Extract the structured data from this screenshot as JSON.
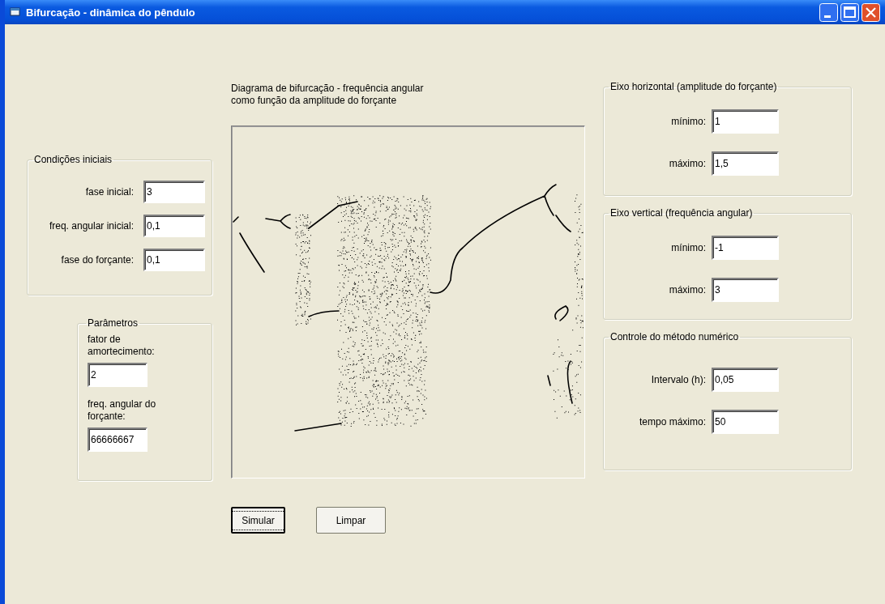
{
  "window": {
    "title": "Bifurcação - dinâmica do pêndulo"
  },
  "initial_conditions": {
    "title": "Condições iniciais",
    "kind": "inline",
    "fields": [
      {
        "label": "fase inicial:",
        "value": "3"
      },
      {
        "label": "freq. angular inicial:",
        "value": "0,1"
      },
      {
        "label": "fase do forçante:",
        "value": "0,1"
      }
    ]
  },
  "parameters": {
    "title": "Parâmetros",
    "kind": "stacked",
    "fields": [
      {
        "label": "fator de amortecimento:",
        "value": "2"
      },
      {
        "label": "freq. angular do forçante:",
        "value": "66666667"
      }
    ]
  },
  "plot": {
    "caption": [
      "Diagrama de bifurcação - frequência angular",
      "como função da amplitude do forçante"
    ]
  },
  "buttons": [
    {
      "label": "Simular",
      "default": true
    },
    {
      "label": "Limpar",
      "default": false
    }
  ],
  "right_groups": [
    {
      "title": "Eixo horizontal (amplitude do forçante)",
      "kind": "inline",
      "fields": [
        {
          "label": "mínimo:",
          "value": "1"
        },
        {
          "label": "máximo:",
          "value": "1,5"
        }
      ]
    },
    {
      "title": "Eixo vertical (frequência angular)",
      "kind": "inline",
      "fields": [
        {
          "label": "mínimo:",
          "value": "-1"
        },
        {
          "label": "máximo:",
          "value": "3"
        }
      ]
    },
    {
      "title": "Controle do método numérico",
      "kind": "inline",
      "fields": [
        {
          "label": "Intervalo (h):",
          "value": "0,05"
        },
        {
          "label": "tempo máximo:",
          "value": "50"
        }
      ]
    }
  ]
}
